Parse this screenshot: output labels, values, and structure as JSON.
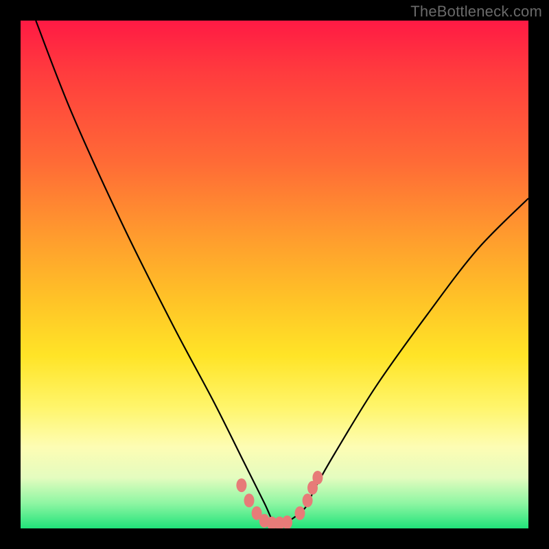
{
  "watermark": "TheBottleneck.com",
  "chart_data": {
    "type": "line",
    "title": "",
    "xlabel": "",
    "ylabel": "",
    "xlim": [
      0,
      100
    ],
    "ylim": [
      0,
      100
    ],
    "grid": false,
    "legend": false,
    "series": [
      {
        "name": "black-curve",
        "color": "#000000",
        "x": [
          3,
          10,
          20,
          30,
          38,
          44,
          48,
          50,
          52,
          56,
          58,
          62,
          70,
          80,
          90,
          100
        ],
        "y": [
          100,
          82,
          60,
          40,
          25,
          13,
          5,
          1,
          1,
          4,
          8,
          15,
          28,
          42,
          55,
          65
        ]
      },
      {
        "name": "pink-beads",
        "color": "#e77b78",
        "x": [
          43.5,
          45.0,
          46.5,
          48.0,
          49.5,
          51.0,
          52.5,
          55.0,
          56.5,
          57.5,
          58.5
        ],
        "y": [
          8.5,
          5.5,
          3.0,
          1.5,
          1.0,
          1.0,
          1.2,
          3.0,
          5.5,
          8.0,
          10.0
        ]
      }
    ],
    "gradient_stops": [
      {
        "pos": 0,
        "color": "#ff1a44"
      },
      {
        "pos": 50,
        "color": "#ffcc28"
      },
      {
        "pos": 85,
        "color": "#fdfdb4"
      },
      {
        "pos": 100,
        "color": "#20e37a"
      }
    ]
  }
}
